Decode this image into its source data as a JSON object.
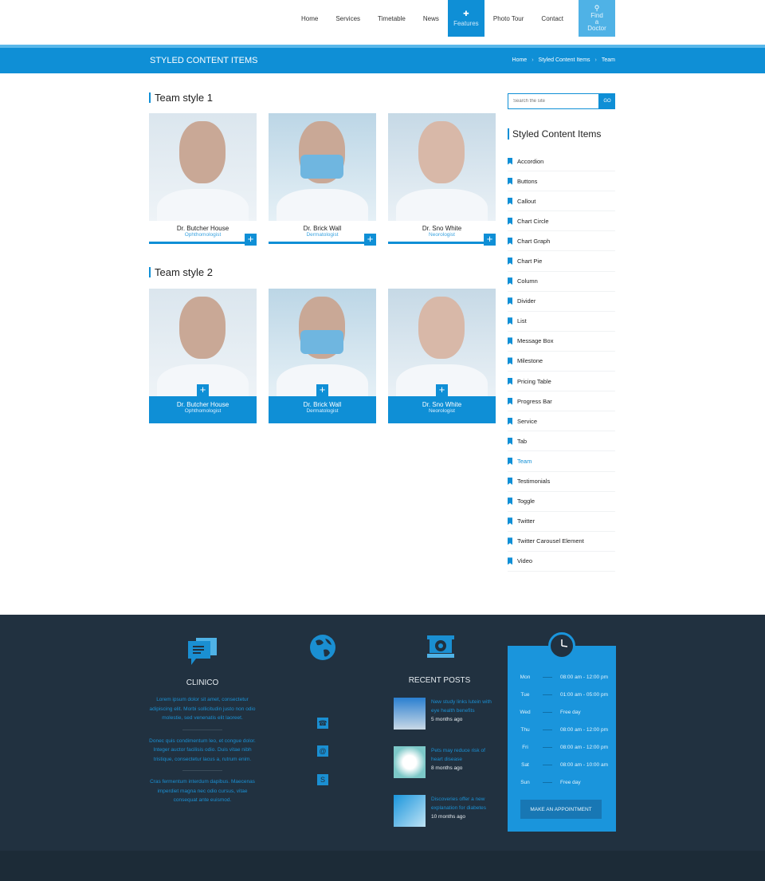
{
  "nav": {
    "items": [
      "Home",
      "Services",
      "Timetable",
      "News",
      "Features",
      "Photo Tour",
      "Contact"
    ],
    "find_line1": "Find",
    "find_line2": "a Doctor",
    "active": "Features"
  },
  "banner": {
    "title": "STYLED CONTENT ITEMS",
    "breadcrumb": [
      "Home",
      "Styled Content Items",
      "Team"
    ]
  },
  "team1": {
    "title": "Team style 1",
    "members": [
      {
        "name": "Dr. Butcher House",
        "role": "Ophthomologist"
      },
      {
        "name": "Dr. Brick Wall",
        "role": "Dermatologist"
      },
      {
        "name": "Dr. Sno White",
        "role": "Neorologist"
      }
    ]
  },
  "team2": {
    "title": "Team style 2",
    "members": [
      {
        "name": "Dr. Butcher House",
        "role": "Ophthomologist"
      },
      {
        "name": "Dr. Brick Wall",
        "role": "Dermatologist"
      },
      {
        "name": "Dr. Sno White",
        "role": "Neorologist"
      }
    ]
  },
  "search": {
    "placeholder": "Search the site",
    "button": "GO"
  },
  "sidebar": {
    "title": "Styled Content Items",
    "current": "Team",
    "items": [
      "Accordion",
      "Buttons",
      "Callout",
      "Chart Circle",
      "Chart Graph",
      "Chart Pie",
      "Column",
      "Divider",
      "List",
      "Message Box",
      "Milestone",
      "Pricing Table",
      "Progress Bar",
      "Service",
      "Tab",
      "Team",
      "Testimonials",
      "Toggle",
      "Twitter",
      "Twitter Carousel Element",
      "Video"
    ]
  },
  "footer": {
    "about": {
      "title": "CLINICO",
      "paragraphs": [
        "Lorem ipsum dolor sit amet, consectetur adipiscing elit. Morbi sollicitudin justo non odio molestie, sed venenatis elit laoreet.",
        "Donec quis condimentum leo, et congue dolor. Integer auctor facilisis odio. Duis vitae nibh tristique, consectetur lacus a, rutrum enim.",
        "Cras fermentum interdum dapibus. Maecenas imperdiet magna nec odio cursus, vitae consequat ante euismod."
      ]
    },
    "recent": {
      "title": "RECENT POSTS",
      "posts": [
        {
          "title": "New study links lutein with eye health benefits",
          "ago": "5 months ago"
        },
        {
          "title": "Pets may reduce risk of heart disease",
          "ago": "8 months ago"
        },
        {
          "title": "Discoveries offer a new explanation for diabetes",
          "ago": "10 months ago"
        }
      ]
    },
    "hours": [
      {
        "day": "Mon",
        "time": "08:00 am - 12:00 pm"
      },
      {
        "day": "Tue",
        "time": "01:00 am - 05:00 pm"
      },
      {
        "day": "Wed",
        "time": "Free day"
      },
      {
        "day": "Thu",
        "time": "08:00 am - 12:00 pm"
      },
      {
        "day": "Fri",
        "time": "08:00 am - 12:00 pm"
      },
      {
        "day": "Sat",
        "time": "08:00 am - 10:00 am"
      },
      {
        "day": "Sun",
        "time": "Free day"
      }
    ],
    "appointment": "MAKE AN APPOINTMENT"
  },
  "colors": {
    "accent": "#0f8fd6",
    "footer": "#213140"
  }
}
